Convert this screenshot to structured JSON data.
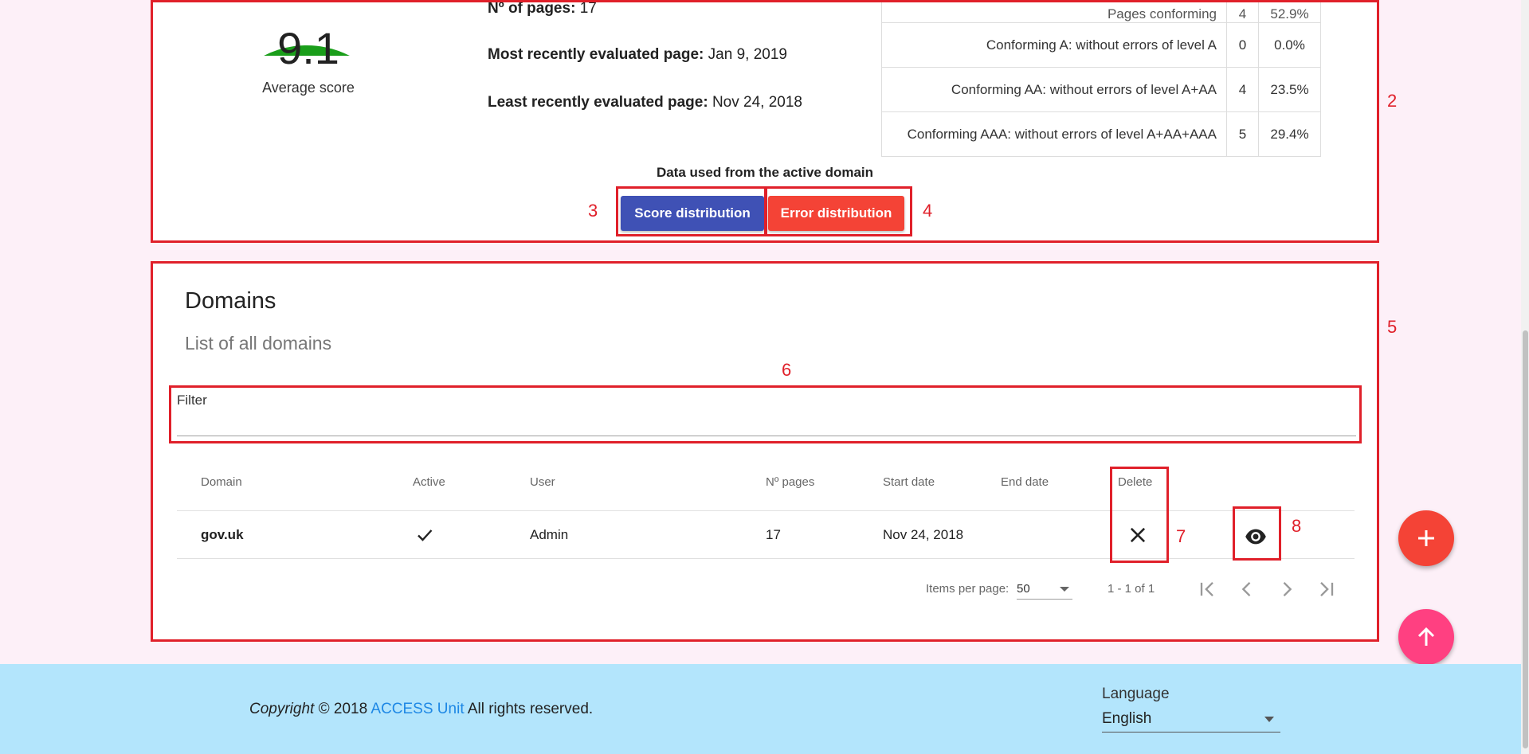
{
  "stats": {
    "score_value": "9.1",
    "score_caption": "Average score",
    "pages_label": "Nº of pages:",
    "pages_value": "17",
    "recent_label": "Most recently evaluated page:",
    "recent_value": "Jan 9, 2019",
    "least_label": "Least recently evaluated page:",
    "least_value": "Nov 24, 2018",
    "gauge_score": 9.1,
    "gauge_max": 10,
    "gauge_color": "#1a9e1a",
    "conformance": [
      {
        "label": "Pages conforming",
        "count": "4",
        "percent": "52.9%"
      },
      {
        "label": "Conforming A: without errors of level A",
        "count": "0",
        "percent": "0.0%"
      },
      {
        "label": "Conforming AA: without errors of level A+AA",
        "count": "4",
        "percent": "23.5%"
      },
      {
        "label": "Conforming AAA: without errors of level A+AA+AAA",
        "count": "5",
        "percent": "29.4%"
      }
    ],
    "data_used": "Data used from the active domain",
    "score_button": "Score distribution",
    "error_button": "Error distribution"
  },
  "domains": {
    "title": "Domains",
    "subtitle": "List of all domains",
    "filter_label": "Filter",
    "filter_value": "",
    "columns": [
      "Domain",
      "Active",
      "User",
      "Nº pages",
      "Start date",
      "End date",
      "Delete"
    ],
    "rows": [
      {
        "domain": "gov.uk",
        "active": true,
        "user": "Admin",
        "pages": "17",
        "start": "Nov 24, 2018",
        "end": ""
      }
    ],
    "items_per_page_label": "Items per page:",
    "items_per_page": "50",
    "range": "1 - 1 of 1"
  },
  "footer": {
    "copyright_italic": "Copyright",
    "copyright_year": "© 2018",
    "org_link": "ACCESS Unit",
    "rights": "All rights reserved.",
    "language_label": "Language",
    "language_value": "English"
  },
  "annotations": [
    "2",
    "3",
    "4",
    "5",
    "6",
    "7",
    "8"
  ],
  "colors": {
    "primary": "#3f51b5",
    "warn": "#f44336",
    "accent": "#ff4081",
    "footer_bg": "#b3e5fc",
    "page_bg": "#fdf0f8",
    "annotation": "#e0202a"
  }
}
